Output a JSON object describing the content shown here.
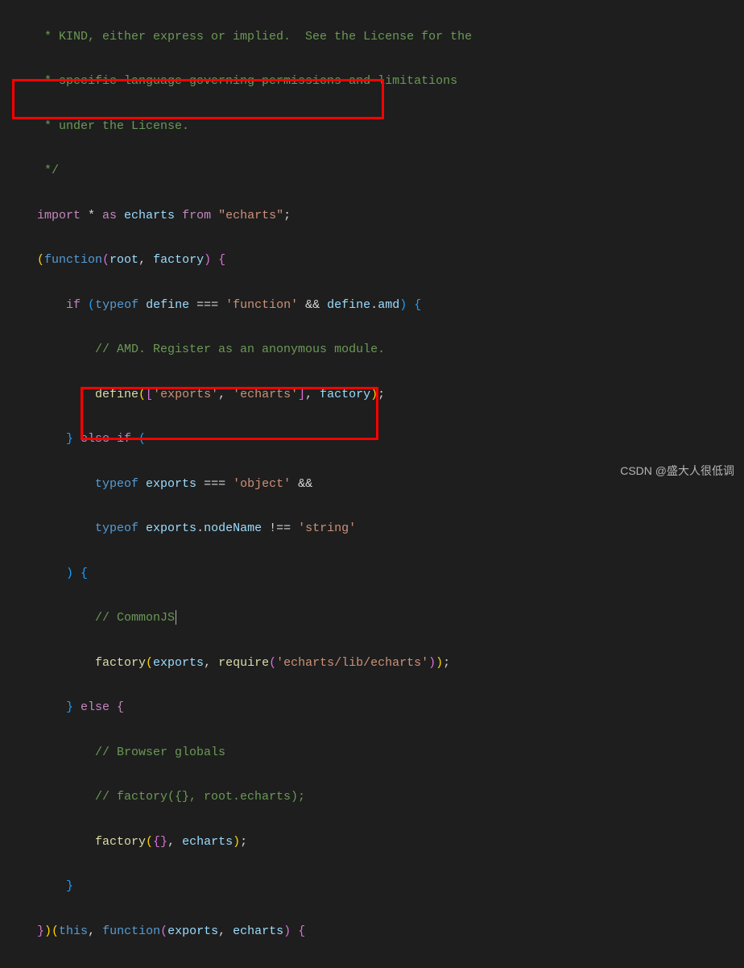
{
  "watermark": "CSDN @盛大人很低调",
  "code": {
    "l1": " * KIND, either express or implied.  See the License for the",
    "l2": " * specific language governing permissions and limitations",
    "l3": " * under the License.",
    "l4": " */",
    "imp_kw": "import",
    "star": " * ",
    "as": "as",
    "ech": " echarts ",
    "from": "from",
    "imp_str": " \"echarts\"",
    "fn_open1": "(",
    "kw_function": "function",
    "fn_open2": "(",
    "p_root": "root",
    "comma": ", ",
    "p_factory": "factory",
    "fn_close": ") {",
    "if": "if",
    "sp": " ",
    "po": "(",
    "typeof": "typeof",
    "define": "define",
    "eq": " === ",
    "s_function": "'function'",
    "amp": " && ",
    "dot": ".",
    "amd": "amd",
    "pc": ") ",
    "ob": "{",
    "c_amd": "// AMD. Register as an anonymous module.",
    "define_call": "define",
    "sq_exports": "'exports'",
    "sq_echarts": "'echarts'",
    "fact": "factory",
    "cb": "}",
    "elseif": " else if (",
    "exports": "exports",
    "s_object": "'object'",
    "and": " &&",
    "nodeName": "nodeName",
    "neq": " !== ",
    "s_string": "'string'",
    "pc2": ") ",
    "ob2": "{",
    "c_cjs": "// CommonJS",
    "require": "require",
    "req_str": "'echarts/lib/echarts'",
    "else": " else {",
    "c_browser": "// Browser globals",
    "c_old": "// factory({}, root.echarts);",
    "echarts": "echarts",
    "this": "this",
    "fn": "function"
  }
}
